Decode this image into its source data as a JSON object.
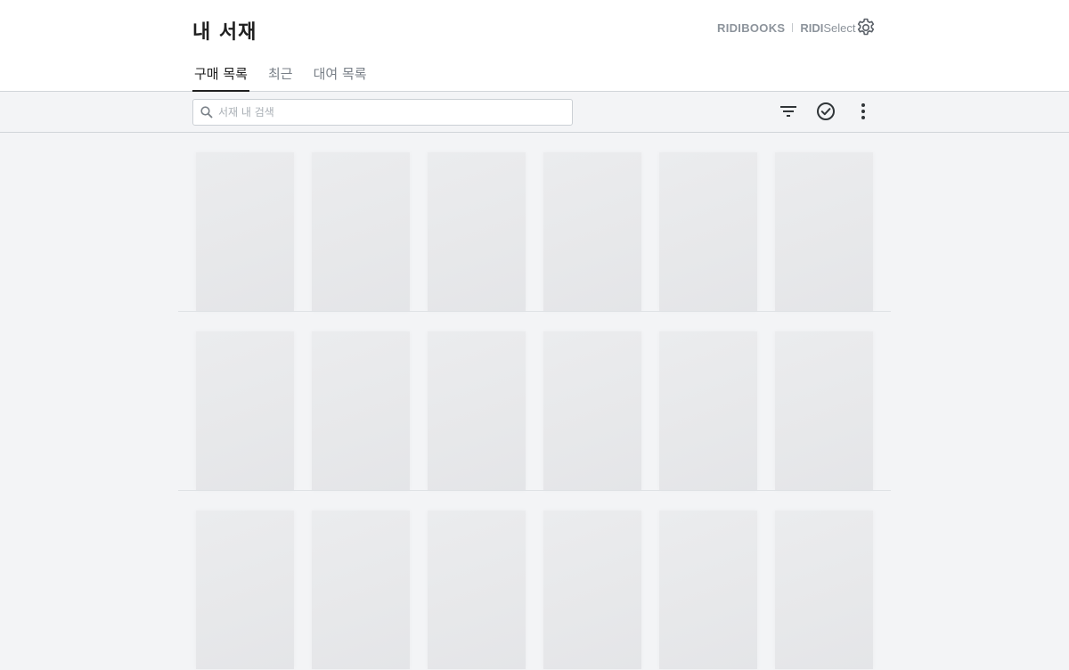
{
  "header": {
    "title": "내 서재",
    "brand_ridibooks": "RIDIBOOKS",
    "brand_select_bold": "RIDI",
    "brand_select_light": "Select",
    "settings_icon": "gear-icon"
  },
  "tabs": [
    {
      "label": "구매 목록",
      "active": true
    },
    {
      "label": "최근",
      "active": false
    },
    {
      "label": "대여 목록",
      "active": false
    }
  ],
  "toolbar": {
    "search_placeholder": "서재 내 검색",
    "search_value": "",
    "filter_icon": "filter-icon",
    "select_icon": "check-circle-icon",
    "more_icon": "more-vertical-icon"
  },
  "shelves": {
    "rows": 3,
    "books_per_row": 6,
    "state": "loading placeholders"
  },
  "colors": {
    "background": "#f3f4f6",
    "header_bg": "#ffffff",
    "placeholder": "#e8e9eb",
    "brand_gray": "#8c939b"
  }
}
